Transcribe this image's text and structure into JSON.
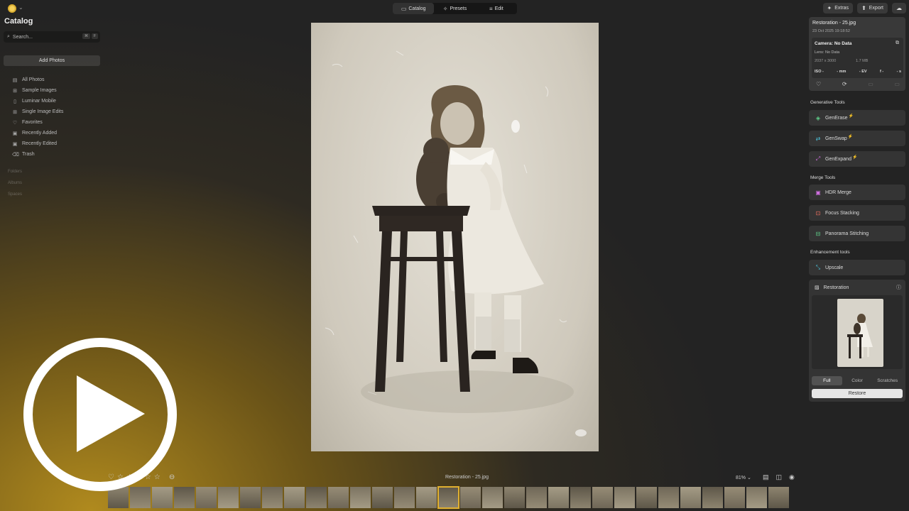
{
  "topbar": {
    "modes": [
      {
        "label": "Catalog",
        "icon": "folder-icon",
        "active": true
      },
      {
        "label": "Presets",
        "icon": "presets-icon",
        "active": false
      },
      {
        "label": "Edit",
        "icon": "sliders-icon",
        "active": false
      }
    ],
    "extras_label": "Extras",
    "export_label": "Export"
  },
  "sidebar": {
    "title": "Catalog",
    "search_placeholder": "Search...",
    "search_shortcut_1": "⌘",
    "search_shortcut_2": "F",
    "add_photos_label": "Add Photos",
    "items": [
      {
        "label": "All Photos",
        "icon": "photos-icon"
      },
      {
        "label": "Sample Images",
        "icon": "sample-images-icon"
      },
      {
        "label": "Luminar Mobile",
        "icon": "mobile-icon"
      },
      {
        "label": "Single Image Edits",
        "icon": "grid-icon"
      },
      {
        "label": "Favorites",
        "icon": "heart-icon"
      },
      {
        "label": "Recently Added",
        "icon": "recently-added-icon"
      },
      {
        "label": "Recently Edited",
        "icon": "recently-edited-icon"
      },
      {
        "label": "Trash",
        "icon": "trash-icon"
      }
    ],
    "sections": [
      "Folders",
      "Albums",
      "Spaces"
    ]
  },
  "info": {
    "title": "Restoration - 25.jpg",
    "date": "23 Oct 2025 19:18:52",
    "camera": "Camera: No Data",
    "lens": "Lens: No Data",
    "dimensions": "2037 x 3000",
    "filesize": "1.7 MB",
    "iso": "ISO -",
    "focal": "- mm",
    "ev": "- EV",
    "aperture": "f -",
    "shutter": "- s"
  },
  "tools": {
    "generative_label": "Generative Tools",
    "generative": [
      {
        "label": "GenErase",
        "icon": "generase-icon",
        "color": "#5fd08a"
      },
      {
        "label": "GenSwap",
        "icon": "genswap-icon",
        "color": "#4cc7e0"
      },
      {
        "label": "GenExpand",
        "icon": "genexpand-icon",
        "color": "#d070e0"
      }
    ],
    "merge_label": "Merge Tools",
    "merge": [
      {
        "label": "HDR Merge",
        "icon": "hdr-merge-icon",
        "color": "#d070e0"
      },
      {
        "label": "Focus Stacking",
        "icon": "focus-stacking-icon",
        "color": "#f07060"
      },
      {
        "label": "Panorama Stitching",
        "icon": "panorama-icon",
        "color": "#5fd08a"
      }
    ],
    "enhancement_label": "Enhancement tools",
    "enhancement": [
      {
        "label": "Upscale",
        "icon": "upscale-icon",
        "color": "#4cc7e0"
      }
    ]
  },
  "restoration": {
    "label": "Restoration",
    "tabs": [
      "Full",
      "Color",
      "Scratches"
    ],
    "active_tab": "Full",
    "button_label": "Restore"
  },
  "bottom": {
    "filename": "Restoration - 25.jpg",
    "zoom": "81%",
    "rating_stars": 5,
    "filmstrip_count": 31,
    "selected_index": 15
  },
  "colors": {
    "accent": "#e0b030",
    "restore_button": "#e6e6e6"
  }
}
